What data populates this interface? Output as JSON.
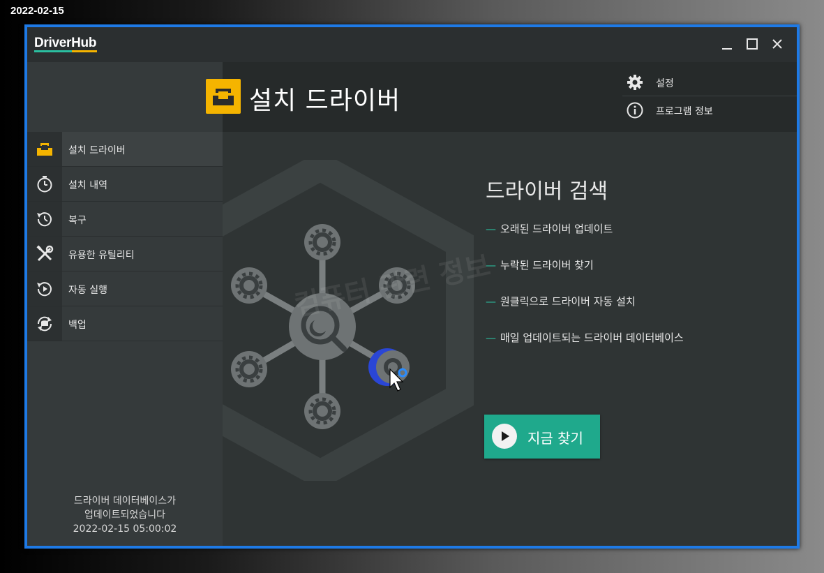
{
  "date_stamp": "2022-02-15",
  "app": {
    "logo": "DriverHub",
    "window_controls": {
      "minimize": "_",
      "maximize": "☐",
      "close": "✕"
    }
  },
  "header": {
    "title": "설치 드라이버",
    "menu": [
      {
        "label": "설정",
        "icon": "gear-icon"
      },
      {
        "label": "프로그램 정보",
        "icon": "info-icon"
      }
    ]
  },
  "sidebar": {
    "items": [
      {
        "label": "설치 드라이버",
        "icon": "install-tray-icon",
        "active": true
      },
      {
        "label": "설치 내역",
        "icon": "stopwatch-icon"
      },
      {
        "label": "복구",
        "icon": "history-icon"
      },
      {
        "label": "유용한 유틸리티",
        "icon": "tools-icon"
      },
      {
        "label": "자동 실행",
        "icon": "autorun-icon"
      },
      {
        "label": "백업",
        "icon": "backup-icon"
      }
    ],
    "footer": {
      "line1": "드라이버 데이터베이스가",
      "line2": "업데이트되었습니다",
      "line3": "2022-02-15 05:00:02"
    }
  },
  "main": {
    "title": "드라이버 검색",
    "features": [
      "오래된 드라이버 업데이트",
      "누락된 드라이버 찾기",
      "원클릭으로 드라이버 자동 설치",
      "매일 업데이트되는 드라이버 데이터베이스"
    ],
    "scan_button": "지금 찾기",
    "watermark": "컴퓨터 관련 정보"
  },
  "colors": {
    "accent_teal": "#1fa98c",
    "accent_yellow": "#f5b400",
    "window_border": "#1e7ae6"
  }
}
